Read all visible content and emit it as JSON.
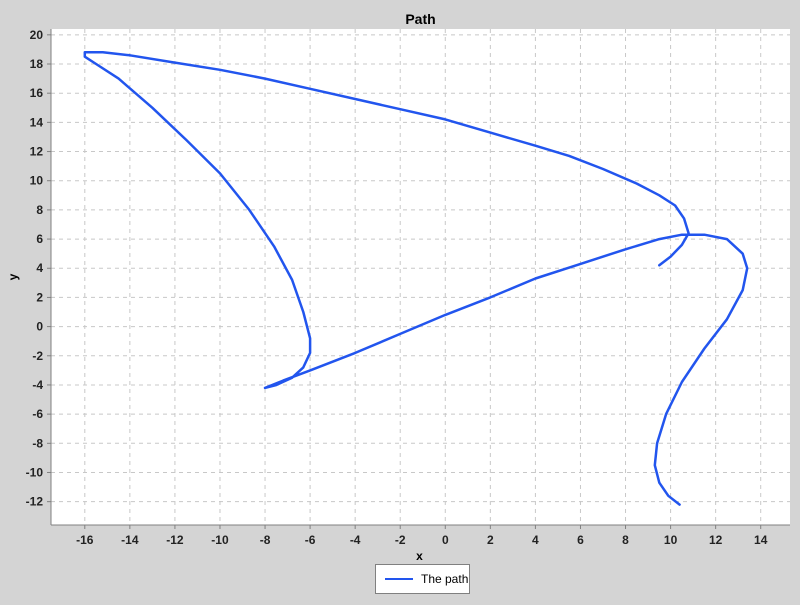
{
  "chart_data": {
    "type": "line",
    "title": "Path",
    "xlabel": "x",
    "ylabel": "y",
    "xlim": [
      -17.5,
      15.3
    ],
    "ylim": [
      -13.6,
      20.4
    ],
    "xticks": [
      -16,
      -14,
      -12,
      -10,
      -8,
      -6,
      -4,
      -2,
      0,
      2,
      4,
      6,
      8,
      10,
      12,
      14
    ],
    "yticks": [
      -12,
      -10,
      -8,
      -6,
      -4,
      -2,
      0,
      2,
      4,
      6,
      8,
      10,
      12,
      14,
      16,
      18,
      20
    ],
    "grid": true,
    "legend_position": "bottom",
    "series": [
      {
        "name": "The path",
        "color": "#2255ee",
        "x": [
          9.5,
          10.0,
          10.5,
          10.8,
          10.6,
          10.2,
          9.5,
          8.5,
          7.0,
          5.5,
          4.0,
          2.0,
          0.0,
          -2.0,
          -4.0,
          -6.0,
          -8.0,
          -10.0,
          -12.0,
          -14.0,
          -15.2,
          -16.0,
          -16.0,
          -15.5,
          -14.5,
          -13.0,
          -11.5,
          -10.0,
          -8.7,
          -7.6,
          -6.8,
          -6.3,
          -6.0,
          -6.0,
          -6.3,
          -6.8,
          -7.5,
          -8.0,
          -7.2,
          -6.0,
          -4.0,
          -2.0,
          0.0,
          2.0,
          4.0,
          6.0,
          8.0,
          9.5,
          10.5,
          11.5,
          12.5,
          13.2,
          13.4,
          13.2,
          12.5,
          11.5,
          10.5,
          9.8,
          9.4,
          9.3,
          9.5,
          9.9,
          10.4
        ],
        "y": [
          4.2,
          4.8,
          5.6,
          6.4,
          7.4,
          8.3,
          9.0,
          9.8,
          10.8,
          11.7,
          12.4,
          13.3,
          14.2,
          14.9,
          15.6,
          16.3,
          17.0,
          17.6,
          18.1,
          18.6,
          18.8,
          18.8,
          18.5,
          18.0,
          17.0,
          15.0,
          12.8,
          10.5,
          8.0,
          5.5,
          3.2,
          1.0,
          -0.8,
          -1.8,
          -2.8,
          -3.5,
          -4.0,
          -4.2,
          -3.7,
          -3.0,
          -1.8,
          -0.5,
          0.8,
          2.0,
          3.3,
          4.3,
          5.3,
          6.0,
          6.3,
          6.3,
          6.0,
          5.0,
          4.0,
          2.5,
          0.5,
          -1.5,
          -3.8,
          -6.0,
          -8.0,
          -9.5,
          -10.7,
          -11.6,
          -12.2
        ]
      }
    ]
  }
}
